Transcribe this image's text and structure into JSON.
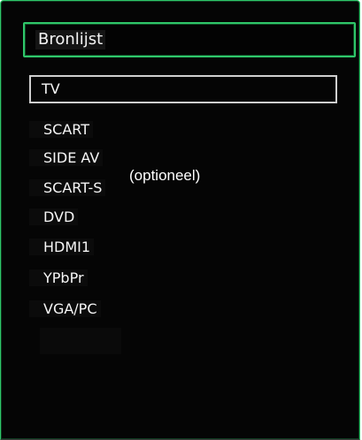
{
  "menu": {
    "title": "Bronlijst",
    "items": [
      {
        "label": "TV",
        "selected": true
      },
      {
        "label": "SCART",
        "selected": false
      },
      {
        "label": "SIDE AV",
        "selected": false
      },
      {
        "label": "SCART-S",
        "selected": false
      },
      {
        "label": "DVD",
        "selected": false
      },
      {
        "label": "HDMI1",
        "selected": false
      },
      {
        "label": "YPbPr",
        "selected": false
      },
      {
        "label": "VGA/PC",
        "selected": false
      }
    ],
    "note": "(optioneel)"
  },
  "colors": {
    "accent": "#2fc76a",
    "background": "#050505",
    "text": "#f6f6f6",
    "selection_border": "#cfcfcf"
  }
}
